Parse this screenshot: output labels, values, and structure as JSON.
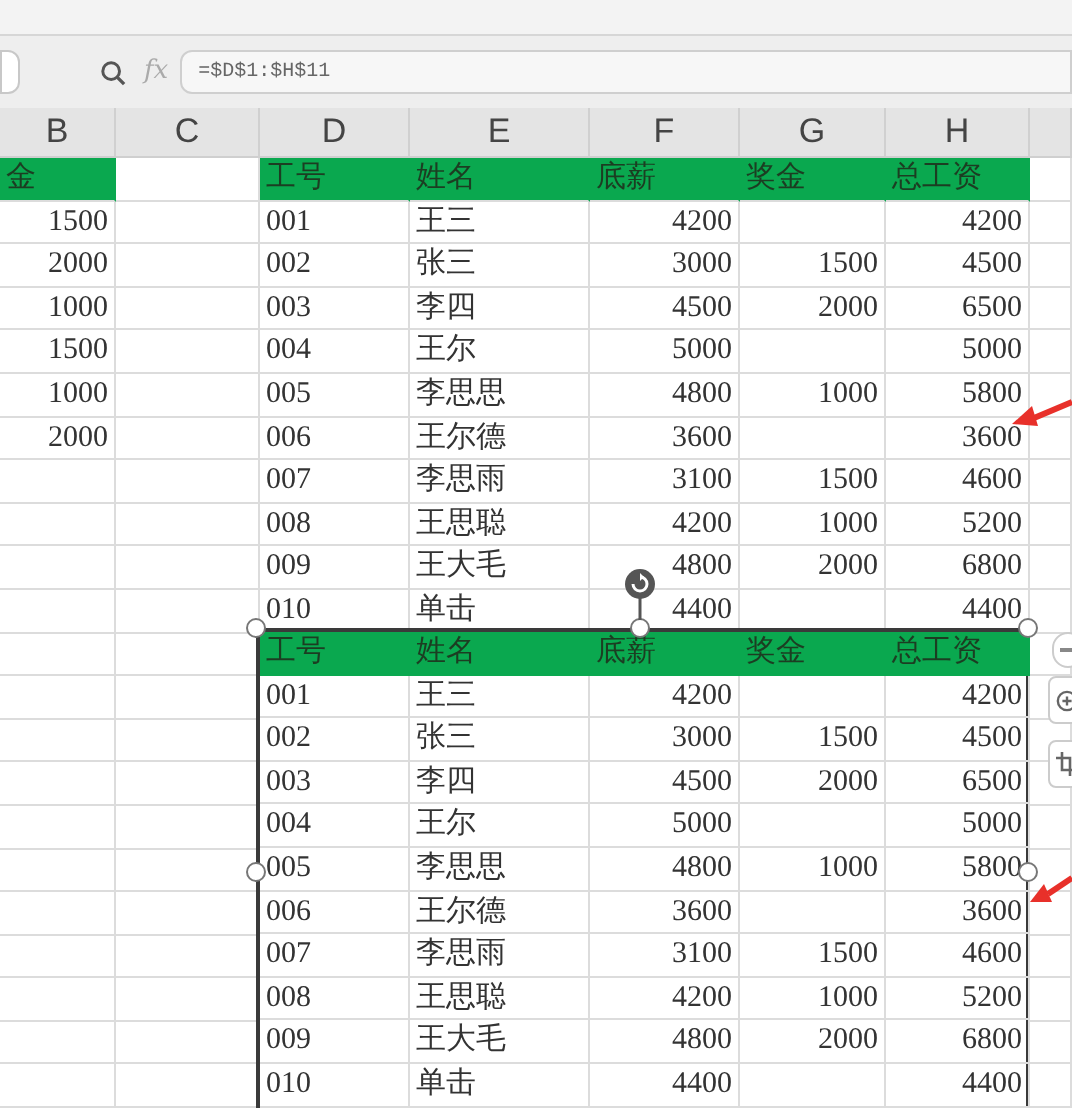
{
  "formula_bar": {
    "fx": "fx",
    "formula": "=$D$1:$H$11"
  },
  "column_headers": [
    "B",
    "C",
    "D",
    "E",
    "F",
    "G",
    "H"
  ],
  "left_column": {
    "header": "金",
    "values": [
      "1500",
      "2000",
      "1000",
      "1500",
      "1000",
      "2000"
    ]
  },
  "table": {
    "columns": [
      "工号",
      "姓名",
      "底薪",
      "奖金",
      "总工资"
    ],
    "rows": [
      {
        "id": "001",
        "name": "王三",
        "base": "4200",
        "total": "4200"
      },
      {
        "id": "002",
        "name": "张三",
        "base": "3000",
        "bonus": "1500",
        "total": "4500"
      },
      {
        "id": "003",
        "name": "李四",
        "base": "4500",
        "bonus": "2000",
        "total": "6500"
      },
      {
        "id": "004",
        "name": "王尔",
        "base": "5000",
        "total": "5000"
      },
      {
        "id": "005",
        "name": "李思思",
        "base": "4800",
        "bonus": "1000",
        "total": "5800"
      },
      {
        "id": "006",
        "name": "王尔德",
        "base": "3600",
        "total": "3600"
      },
      {
        "id": "007",
        "name": "李思雨",
        "base": "3100",
        "bonus": "1500",
        "total": "4600"
      },
      {
        "id": "008",
        "name": "王思聪",
        "base": "4200",
        "bonus": "1000",
        "total": "5200"
      },
      {
        "id": "009",
        "name": "王大毛",
        "base": "4800",
        "bonus": "2000",
        "total": "6800"
      },
      {
        "id": "010",
        "name": "单击",
        "base": "4400",
        "total": "4400"
      }
    ]
  },
  "picture": {
    "selected": true,
    "columns": [
      "工号",
      "姓名",
      "底薪",
      "奖金",
      "总工资"
    ],
    "rows": [
      {
        "id": "001",
        "name": "王三",
        "base": "4200",
        "total": "4200"
      },
      {
        "id": "002",
        "name": "张三",
        "base": "3000",
        "bonus": "1500",
        "total": "4500"
      },
      {
        "id": "003",
        "name": "李四",
        "base": "4500",
        "bonus": "2000",
        "total": "6500"
      },
      {
        "id": "004",
        "name": "王尔",
        "base": "5000",
        "total": "5000"
      },
      {
        "id": "005",
        "name": "李思思",
        "base": "4800",
        "bonus": "1000",
        "total": "5800"
      },
      {
        "id": "006",
        "name": "王尔德",
        "base": "3600",
        "total": "3600"
      },
      {
        "id": "007",
        "name": "李思雨",
        "base": "3100",
        "bonus": "1500",
        "total": "4600"
      },
      {
        "id": "008",
        "name": "王思聪",
        "base": "4200",
        "bonus": "1000",
        "total": "5200"
      },
      {
        "id": "009",
        "name": "王大毛",
        "base": "4800",
        "bonus": "2000",
        "total": "6800"
      },
      {
        "id": "010",
        "name": "单击",
        "base": "4400",
        "total": "4400"
      }
    ]
  }
}
